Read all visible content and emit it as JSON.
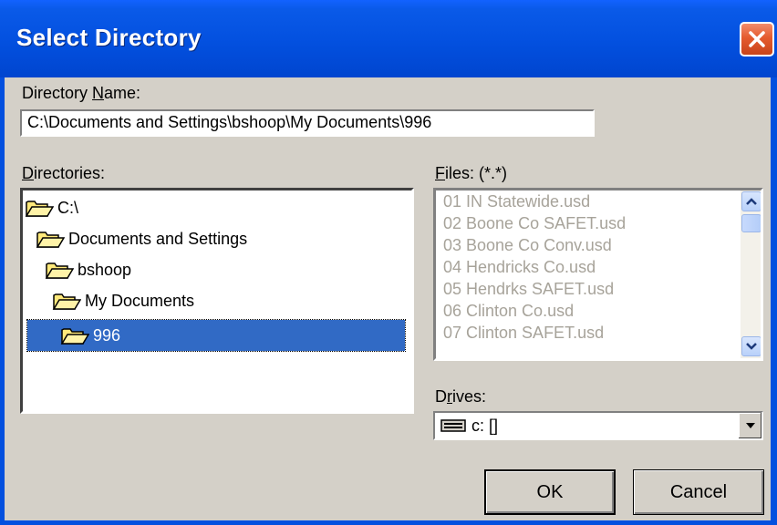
{
  "window": {
    "title": "Select Directory"
  },
  "directory_name": {
    "label_pre": "Directory ",
    "label_accel": "N",
    "label_post": "ame:",
    "value": "C:\\Documents and Settings\\bshoop\\My Documents\\996"
  },
  "directories": {
    "label_accel": "D",
    "label_post": "irectories:",
    "items": [
      {
        "label": "C:\\",
        "icon": "open-folder-icon",
        "selected": false
      },
      {
        "label": "Documents and Settings",
        "icon": "open-folder-icon",
        "selected": false
      },
      {
        "label": "bshoop",
        "icon": "open-folder-icon",
        "selected": false
      },
      {
        "label": "My Documents",
        "icon": "open-folder-icon",
        "selected": false
      },
      {
        "label": "996",
        "icon": "open-folder-icon",
        "selected": true
      }
    ]
  },
  "files": {
    "label_accel": "F",
    "label_post": "iles: (*.*)",
    "items": [
      "01 IN Statewide.usd",
      "02 Boone Co SAFET.usd",
      "03 Boone Co Conv.usd",
      "04 Hendricks Co.usd",
      "05 Hendrks SAFET.usd",
      "06 Clinton Co.usd",
      "07 Clinton SAFET.usd"
    ],
    "disabled_color": "#a7a39a"
  },
  "drives": {
    "label_pre": "D",
    "label_accel": "r",
    "label_post": "ives:",
    "selected": "c: []",
    "icon": "hard-drive-icon"
  },
  "buttons": {
    "ok": "OK",
    "cancel": "Cancel"
  },
  "colors": {
    "selection": "#316ac5",
    "titlebar": "#0350df",
    "dialog_bg": "#d4d0c8"
  }
}
